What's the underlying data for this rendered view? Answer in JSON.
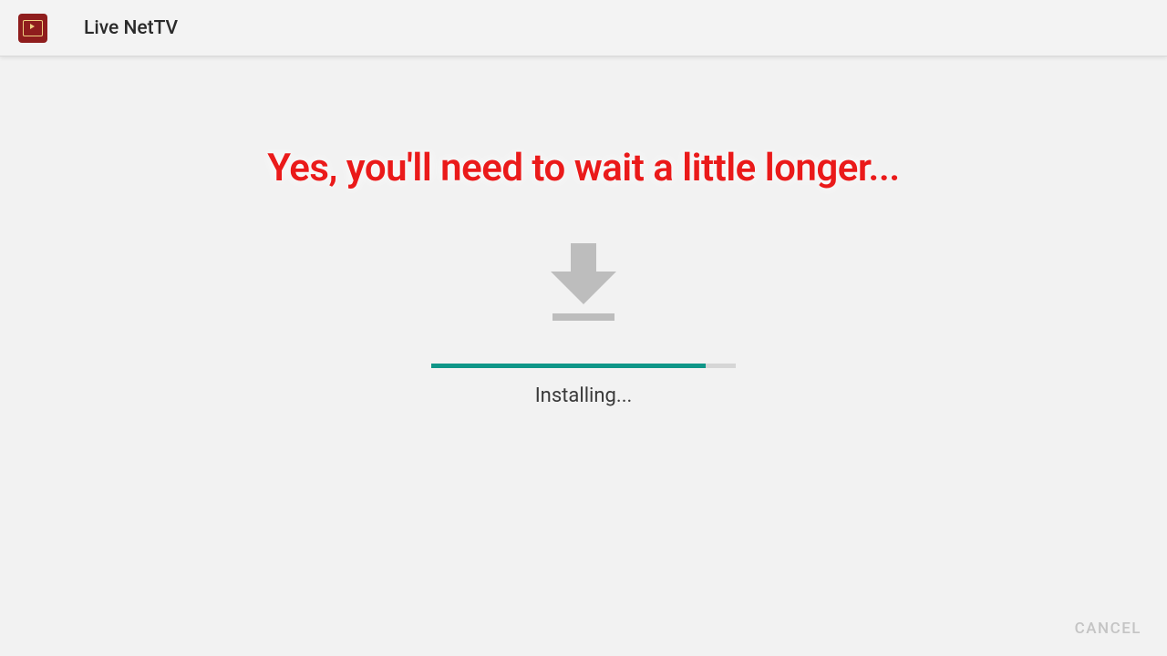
{
  "header": {
    "app_title": "Live NetTV"
  },
  "overlay": {
    "message": "Yes, you'll need to wait a little longer..."
  },
  "install": {
    "status_text": "Installing...",
    "progress_percent": 90,
    "accent_color": "#0f9688"
  },
  "actions": {
    "cancel_label": "CANCEL"
  }
}
